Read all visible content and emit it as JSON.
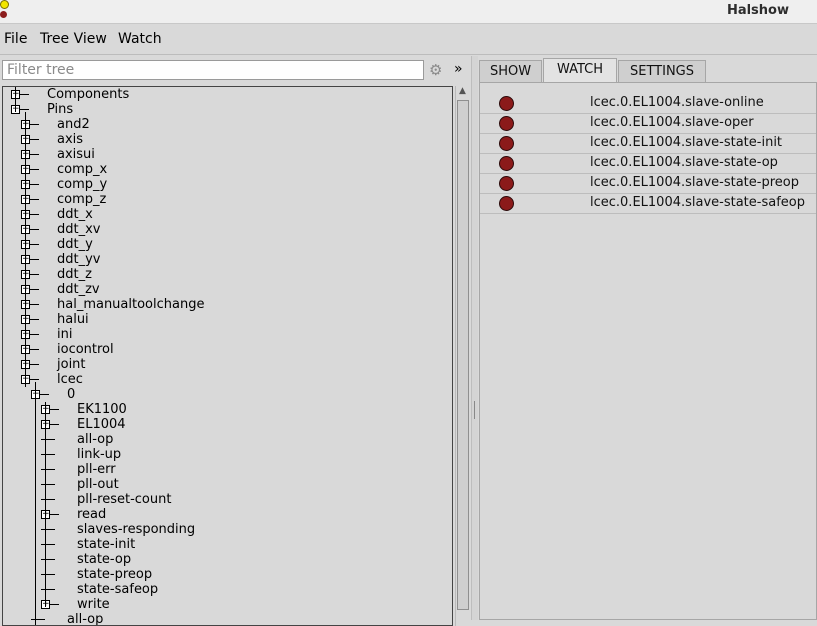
{
  "window": {
    "title": "Halshow"
  },
  "menu": {
    "file": "File",
    "tree_view": "Tree View",
    "watch": "Watch"
  },
  "filter": {
    "placeholder": "Filter tree",
    "more": "»"
  },
  "tree": {
    "rows": [
      {
        "label": "Components",
        "depth": 0,
        "icon": "plus"
      },
      {
        "label": "Pins",
        "depth": 0,
        "icon": "minus"
      },
      {
        "label": "and2",
        "depth": 1,
        "icon": "plus"
      },
      {
        "label": "axis",
        "depth": 1,
        "icon": "plus"
      },
      {
        "label": "axisui",
        "depth": 1,
        "icon": "plus"
      },
      {
        "label": "comp_x",
        "depth": 1,
        "icon": "plus"
      },
      {
        "label": "comp_y",
        "depth": 1,
        "icon": "plus"
      },
      {
        "label": "comp_z",
        "depth": 1,
        "icon": "plus"
      },
      {
        "label": "ddt_x",
        "depth": 1,
        "icon": "plus"
      },
      {
        "label": "ddt_xv",
        "depth": 1,
        "icon": "plus"
      },
      {
        "label": "ddt_y",
        "depth": 1,
        "icon": "plus"
      },
      {
        "label": "ddt_yv",
        "depth": 1,
        "icon": "plus"
      },
      {
        "label": "ddt_z",
        "depth": 1,
        "icon": "plus"
      },
      {
        "label": "ddt_zv",
        "depth": 1,
        "icon": "plus"
      },
      {
        "label": "hal_manualtoolchange",
        "depth": 1,
        "icon": "plus"
      },
      {
        "label": "halui",
        "depth": 1,
        "icon": "plus"
      },
      {
        "label": "ini",
        "depth": 1,
        "icon": "plus"
      },
      {
        "label": "iocontrol",
        "depth": 1,
        "icon": "plus"
      },
      {
        "label": "joint",
        "depth": 1,
        "icon": "plus"
      },
      {
        "label": "lcec",
        "depth": 1,
        "icon": "minus"
      },
      {
        "label": "0",
        "depth": 2,
        "icon": "minus"
      },
      {
        "label": "EK1100",
        "depth": 3,
        "icon": "plus"
      },
      {
        "label": "EL1004",
        "depth": 3,
        "icon": "plus"
      },
      {
        "label": "all-op",
        "depth": 3,
        "icon": "none"
      },
      {
        "label": "link-up",
        "depth": 3,
        "icon": "none"
      },
      {
        "label": "pll-err",
        "depth": 3,
        "icon": "none"
      },
      {
        "label": "pll-out",
        "depth": 3,
        "icon": "none"
      },
      {
        "label": "pll-reset-count",
        "depth": 3,
        "icon": "none"
      },
      {
        "label": "read",
        "depth": 3,
        "icon": "plus"
      },
      {
        "label": "slaves-responding",
        "depth": 3,
        "icon": "none"
      },
      {
        "label": "state-init",
        "depth": 3,
        "icon": "none"
      },
      {
        "label": "state-op",
        "depth": 3,
        "icon": "none"
      },
      {
        "label": "state-preop",
        "depth": 3,
        "icon": "none"
      },
      {
        "label": "state-safeop",
        "depth": 3,
        "icon": "none"
      },
      {
        "label": "write",
        "depth": 3,
        "icon": "plus"
      },
      {
        "label": "all-op",
        "depth": 2,
        "icon": "none"
      }
    ]
  },
  "tabs": [
    {
      "label": "SHOW",
      "active": false
    },
    {
      "label": "WATCH",
      "active": true
    },
    {
      "label": "SETTINGS",
      "active": false
    }
  ],
  "watch": {
    "led_color": "#8b1a1a",
    "items": [
      {
        "pin": "lcec.0.EL1004.slave-online",
        "state": "off"
      },
      {
        "pin": "lcec.0.EL1004.slave-oper",
        "state": "off"
      },
      {
        "pin": "lcec.0.EL1004.slave-state-init",
        "state": "off"
      },
      {
        "pin": "lcec.0.EL1004.slave-state-op",
        "state": "off"
      },
      {
        "pin": "lcec.0.EL1004.slave-state-preop",
        "state": "off"
      },
      {
        "pin": "lcec.0.EL1004.slave-state-safeop",
        "state": "off"
      }
    ]
  }
}
